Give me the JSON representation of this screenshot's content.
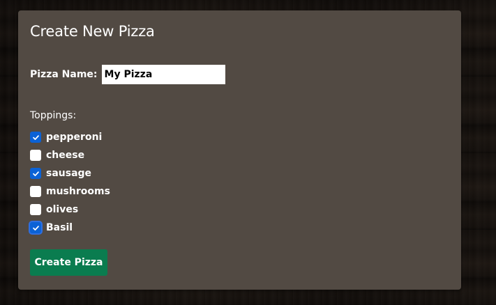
{
  "form": {
    "title": "Create New Pizza",
    "name_label": "Pizza Name:",
    "name_value": "My Pizza",
    "toppings_label": "Toppings:",
    "toppings": [
      {
        "label": "pepperoni",
        "checked": true
      },
      {
        "label": "cheese",
        "checked": false
      },
      {
        "label": "sausage",
        "checked": true
      },
      {
        "label": "mushrooms",
        "checked": false
      },
      {
        "label": "olives",
        "checked": false
      },
      {
        "label": "Basil",
        "checked": true,
        "focused": true
      }
    ],
    "submit_label": "Create Pizza"
  },
  "colors": {
    "panel_bg": "#524a43",
    "checkbox_checked": "#0b62d6",
    "button_bg": "#0a7c4f"
  },
  "icons": {
    "checkbox_check": "checkmark-icon"
  }
}
